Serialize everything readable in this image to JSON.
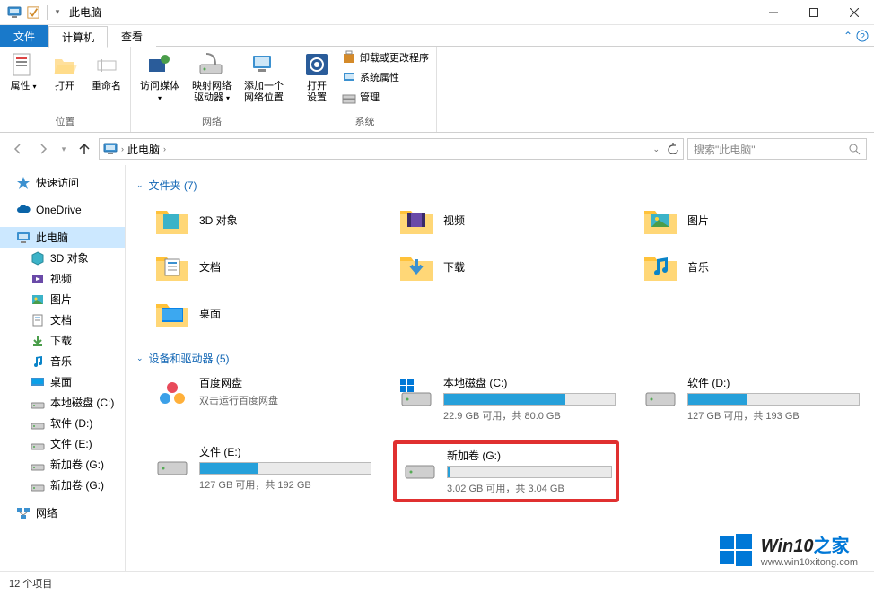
{
  "title": "此电脑",
  "tabs": {
    "file": "文件",
    "computer": "计算机",
    "view": "查看"
  },
  "ribbon": {
    "group1": {
      "label": "位置",
      "properties": "属性",
      "open": "打开",
      "rename": "重命名"
    },
    "group2": {
      "label": "网络",
      "media": "访问媒体",
      "mapdrive": "映射网络\n驱动器",
      "netloc": "添加一个\n网络位置"
    },
    "group3": {
      "label": "系统",
      "settings": "打开\n设置",
      "uninstall": "卸载或更改程序",
      "sysprop": "系统属性",
      "manage": "管理"
    }
  },
  "breadcrumb": {
    "root": "此电脑"
  },
  "search_placeholder": "搜索\"此电脑\"",
  "sidebar": {
    "quick": "快速访问",
    "onedrive": "OneDrive",
    "thispc": "此电脑",
    "items": [
      "3D 对象",
      "视频",
      "图片",
      "文档",
      "下载",
      "音乐",
      "桌面",
      "本地磁盘 (C:)",
      "软件 (D:)",
      "文件 (E:)",
      "新加卷 (G:)",
      "新加卷 (G:)"
    ],
    "network": "网络"
  },
  "section_folders": "文件夹 (7)",
  "folders": [
    "3D 对象",
    "视频",
    "图片",
    "文档",
    "下载",
    "音乐",
    "桌面"
  ],
  "section_drives": "设备和驱动器 (5)",
  "drives": [
    {
      "name": "百度网盘",
      "sub": "双击运行百度网盘",
      "type": "app",
      "fill": 0
    },
    {
      "name": "本地磁盘 (C:)",
      "sub": "22.9 GB 可用，共 80.0 GB",
      "type": "os",
      "fill": 71
    },
    {
      "name": "软件 (D:)",
      "sub": "127 GB 可用，共 193 GB",
      "type": "drive",
      "fill": 34
    },
    {
      "name": "文件 (E:)",
      "sub": "127 GB 可用，共 192 GB",
      "type": "drive",
      "fill": 34
    },
    {
      "name": "新加卷 (G:)",
      "sub": "3.02 GB 可用，共 3.04 GB",
      "type": "drive",
      "fill": 1,
      "hl": true
    }
  ],
  "status": "12 个项目",
  "watermark": {
    "title_a": "Win10",
    "title_b": "之家",
    "url": "www.win10xitong.com"
  }
}
